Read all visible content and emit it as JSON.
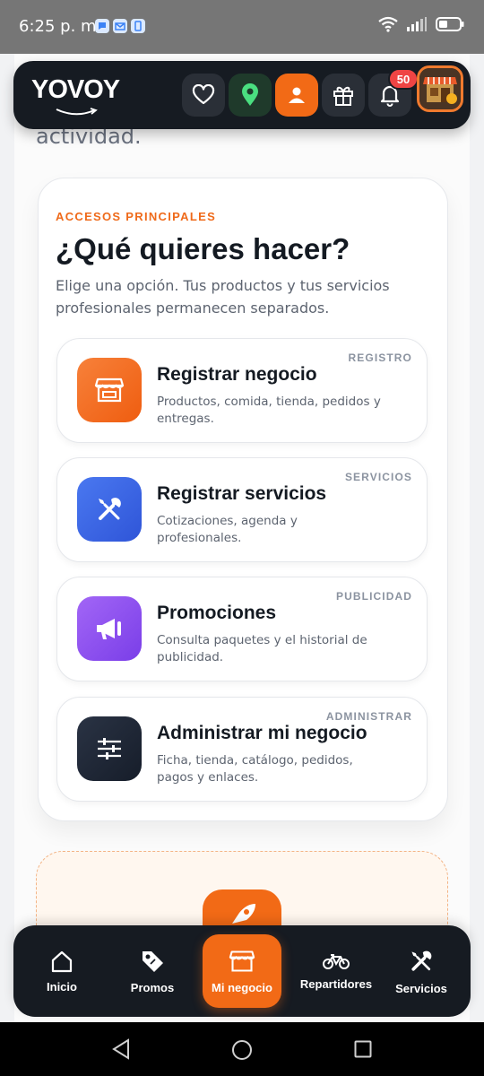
{
  "status_bar": {
    "time": "6:25 p. m.",
    "notification_icons": [
      "chat-icon",
      "mail-icon",
      "phone-app-icon"
    ],
    "right_icons": [
      "wifi-icon",
      "signal-icon",
      "battery-icon"
    ]
  },
  "page": {
    "partial_text": "actividad."
  },
  "header": {
    "logo": "YOVOY",
    "actions": [
      "heart-icon",
      "location-pin-icon",
      "user-icon",
      "gift-icon",
      "bell-icon"
    ],
    "notification_count": "50",
    "accent": "#f26a16",
    "location_color": "#4ade80"
  },
  "access": {
    "label": "ACCESOS PRINCIPALES",
    "title": "¿Qué quieres hacer?",
    "subtitle": "Elige una opción. Tus productos y tus servicios profesionales permanecen separados.",
    "options": [
      {
        "tag": "REGISTRO",
        "title": "Registrar negocio",
        "desc": "Productos, comida, tienda, pedidos y entregas.",
        "icon": "store-icon",
        "color": "#f26a16"
      },
      {
        "tag": "SERVICIOS",
        "title": "Registrar servicios",
        "desc": "Cotizaciones, agenda y profesionales.",
        "icon": "tools-icon",
        "color": "#3b63e6"
      },
      {
        "tag": "PUBLICIDAD",
        "title": "Promociones",
        "desc": "Consulta paquetes y el historial de publicidad.",
        "icon": "megaphone-icon",
        "color": "#8b4cf0"
      },
      {
        "tag": "ADMINISTRAR",
        "title": "Administrar mi negocio",
        "desc": "Ficha, tienda, catálogo, pedidos, pagos y enlaces.",
        "icon": "sliders-icon",
        "color": "#1e2533"
      }
    ]
  },
  "promo": {
    "icon": "rocket-icon"
  },
  "bottom_nav": {
    "items": [
      {
        "label": "Inicio",
        "icon": "home-icon"
      },
      {
        "label": "Promos",
        "icon": "tag-icon"
      },
      {
        "label": "Mi negocio",
        "icon": "store-icon",
        "active": true
      },
      {
        "label": "Repartidores",
        "icon": "bicycle-icon"
      },
      {
        "label": "Servicios",
        "icon": "tools-icon"
      }
    ]
  },
  "system_nav": [
    "back-icon",
    "home-circle-icon",
    "recents-icon"
  ]
}
